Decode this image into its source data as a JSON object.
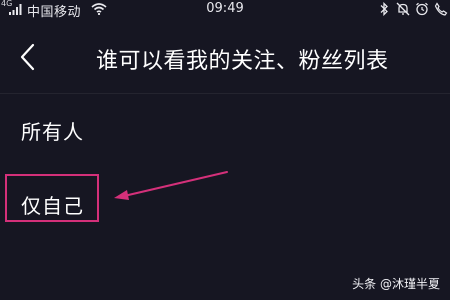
{
  "status_bar": {
    "signal_label": "4G",
    "carrier": "中国移动",
    "time": "09:49",
    "icons": [
      "signal-icon",
      "wifi-icon",
      "bluetooth-icon",
      "mute-icon",
      "alarm-icon",
      "phone-icon"
    ]
  },
  "header": {
    "title": "谁可以看我的关注、粉丝列表",
    "back_icon": "chevron-left-icon"
  },
  "options": [
    {
      "label": "所有人"
    },
    {
      "label": "仅自己"
    }
  ],
  "annotation": {
    "highlight_color": "#d4307a",
    "highlighted_option": "仅自己"
  },
  "watermark": {
    "text": "头条 @沐瑾半夏"
  },
  "colors": {
    "background": "#161622",
    "text": "#ffffff",
    "accent": "#d4307a"
  }
}
